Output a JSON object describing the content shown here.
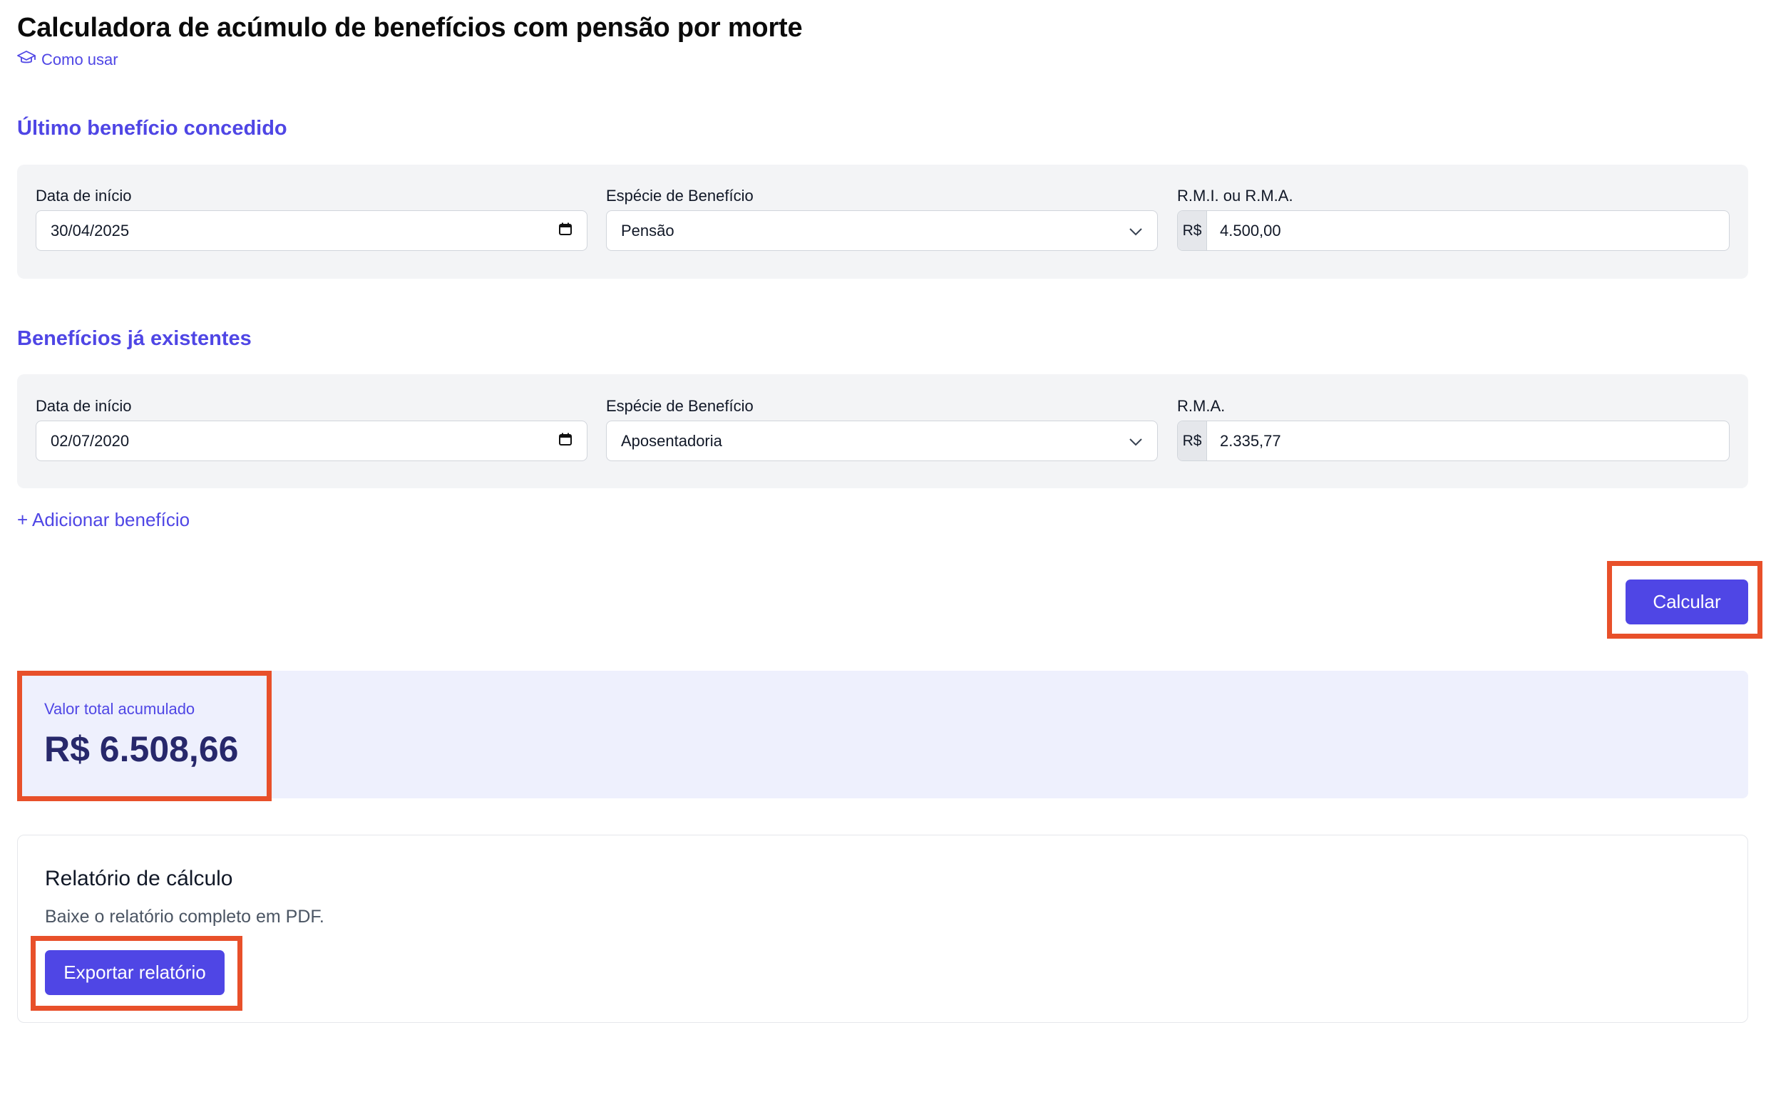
{
  "header": {
    "title": "Calculadora de acúmulo de benefícios com pensão por morte",
    "how_to_use": "Como usar"
  },
  "last_benefit": {
    "section_title": "Último benefício concedido",
    "start_date_label": "Data de início",
    "start_date_value": "30/04/2025",
    "type_label": "Espécie de Benefício",
    "type_value": "Pensão",
    "amount_label": "R.M.I. ou R.M.A.",
    "currency_prefix": "R$",
    "amount_value": "4.500,00"
  },
  "existing_benefits": {
    "section_title": "Benefícios já existentes",
    "items": [
      {
        "start_date_label": "Data de início",
        "start_date_value": "02/07/2020",
        "type_label": "Espécie de Benefício",
        "type_value": "Aposentadoria",
        "amount_label": "R.M.A.",
        "currency_prefix": "R$",
        "amount_value": "2.335,77"
      }
    ],
    "add_label": "+ Adicionar benefício"
  },
  "actions": {
    "calculate_label": "Calcular"
  },
  "result": {
    "label": "Valor total acumulado",
    "value": "R$ 6.508,66"
  },
  "report": {
    "title": "Relatório de cálculo",
    "description": "Baixe o relatório completo em PDF.",
    "export_label": "Exportar relatório"
  },
  "icons": {
    "how_to_use": "graduation-cap-icon",
    "date": "calendar-icon",
    "select": "chevron-down-icon"
  },
  "colors": {
    "accent": "#4f46e5",
    "highlight": "#e8502a",
    "result_bg": "#eef0fd",
    "result_value": "#27286b",
    "panel_bg": "#f3f4f6"
  }
}
